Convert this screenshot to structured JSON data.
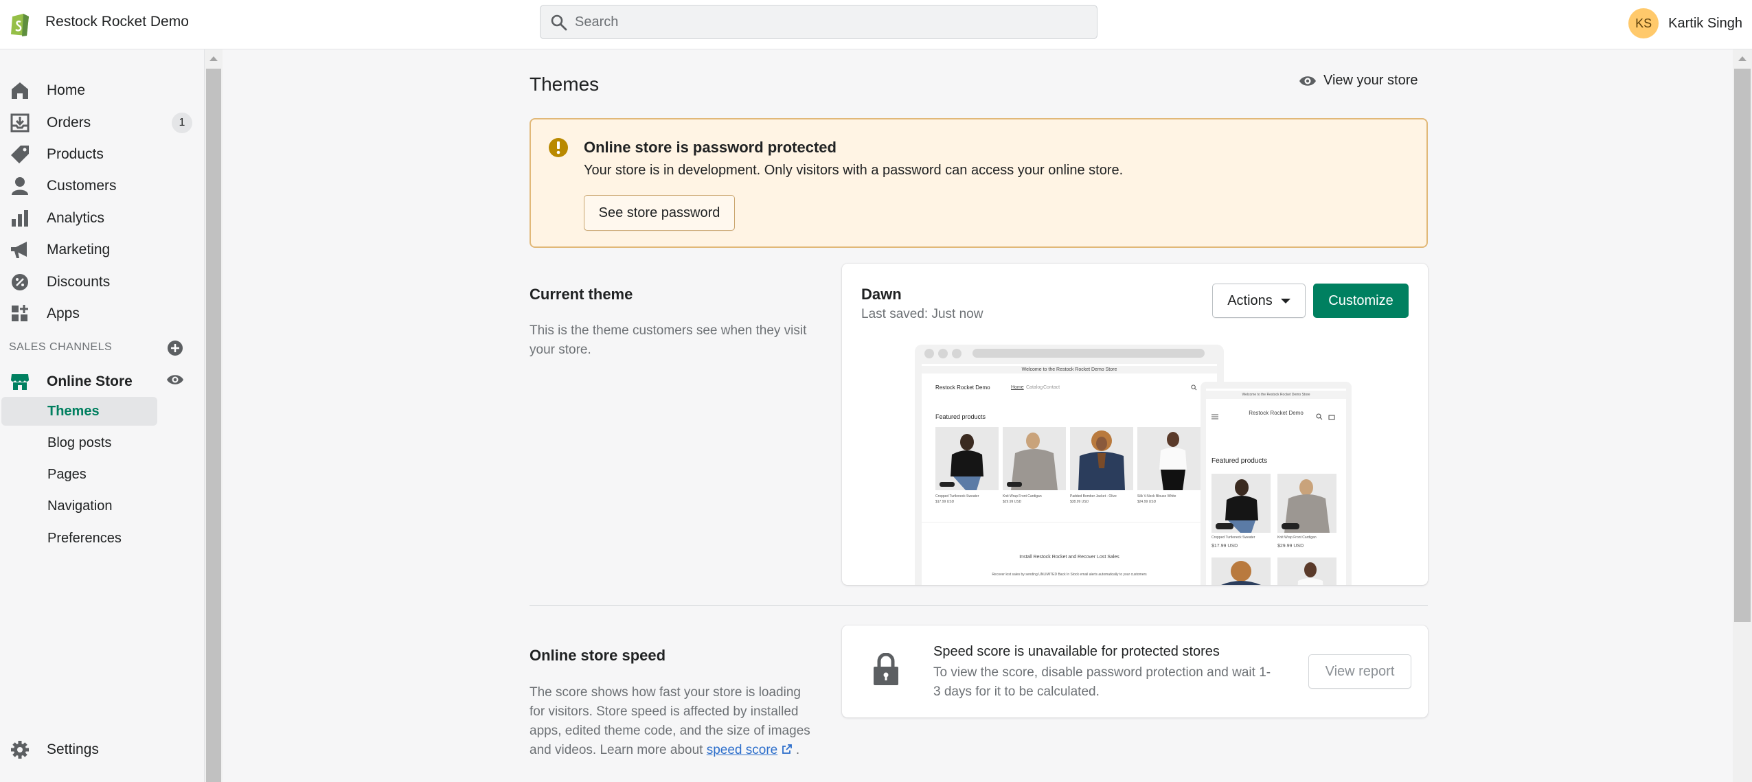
{
  "header": {
    "store_name": "Restock Rocket Demo",
    "search_placeholder": "Search",
    "user_initials": "KS",
    "user_name": "Kartik Singh"
  },
  "sidebar": {
    "items": [
      {
        "label": "Home",
        "icon": "home-icon"
      },
      {
        "label": "Orders",
        "icon": "orders-icon",
        "badge": "1"
      },
      {
        "label": "Products",
        "icon": "tag-icon"
      },
      {
        "label": "Customers",
        "icon": "person-icon"
      },
      {
        "label": "Analytics",
        "icon": "bar-chart-icon"
      },
      {
        "label": "Marketing",
        "icon": "megaphone-icon"
      },
      {
        "label": "Discounts",
        "icon": "discount-icon"
      },
      {
        "label": "Apps",
        "icon": "apps-icon"
      }
    ],
    "sales_channels_label": "SALES CHANNELS",
    "online_store": "Online Store",
    "sub_items": [
      "Themes",
      "Blog posts",
      "Pages",
      "Navigation",
      "Preferences"
    ],
    "settings": "Settings"
  },
  "page": {
    "title": "Themes",
    "view_store": "View your store"
  },
  "banner": {
    "title": "Online store is password protected",
    "text": "Your store is in development. Only visitors with a password can access your online store.",
    "button": "See store password",
    "accent": "#e1b878"
  },
  "current_theme": {
    "heading": "Current theme",
    "description": "This is the theme customers see when they visit your store.",
    "name": "Dawn",
    "last_saved": "Last saved: Just now",
    "actions_label": "Actions",
    "customize_label": "Customize",
    "customize_color": "#008060"
  },
  "preview": {
    "desktop": {
      "announcement": "Welcome to the Restock Rocket Demo Store",
      "brand": "Restock Rocket Demo",
      "nav": [
        "Home",
        "Catalog",
        "Contact"
      ],
      "section": "Featured products",
      "products": [
        {
          "name": "Cropped Turtleneck Sweater",
          "price": "$17.99 USD",
          "badge": "Sold out"
        },
        {
          "name": "Knit Wrap Front Cardigan",
          "price": "$29.99 USD",
          "badge": "Sold out"
        },
        {
          "name": "Padded Bomber Jacket - Olive",
          "price": "$38.99 USD"
        },
        {
          "name": "Silk V-Neck Blouse White",
          "price": "$24.99 USD"
        }
      ],
      "footer_title": "Install Restock Rocket and Recover Lost Sales",
      "footer_text": "Recover lost sales by sending UNLIMITED Back In Stock email alerts automatically to your customers"
    },
    "mobile": {
      "announcement": "Welcome to the Restock Rocket Demo Store",
      "brand": "Restock Rocket Demo",
      "section": "Featured products",
      "products": [
        {
          "name": "Cropped Turtleneck Sweater",
          "price": "$17.99 USD",
          "badge": "Sold out"
        },
        {
          "name": "Knit Wrap Front Cardigan",
          "price": "$29.99 USD",
          "badge": "Sold out"
        }
      ]
    }
  },
  "speed": {
    "heading": "Online store speed",
    "description": "The score shows how fast your store is loading for visitors. Store speed is affected by installed apps, edited theme code, and the size of images and videos. Learn more about",
    "link": "speed score",
    "card_title": "Speed score is unavailable for protected stores",
    "card_text": "To view the score, disable password protection and wait 1-3 days for it to be calculated.",
    "button": "View report"
  }
}
